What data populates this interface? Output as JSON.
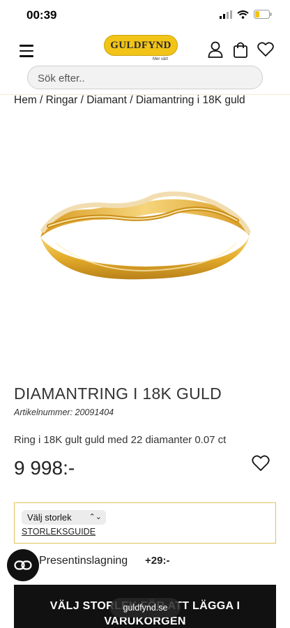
{
  "status_bar": {
    "time": "00:39",
    "icons": [
      "signal-icon",
      "wifi-icon",
      "battery-icon"
    ]
  },
  "header": {
    "logo_text": "GULDFYND",
    "logo_sub": "Mer värt",
    "icons": [
      "menu-icon",
      "account-icon",
      "bag-icon",
      "heart-icon"
    ],
    "search_placeholder": "Sök efter.."
  },
  "breadcrumb": "Hem / Ringar / Diamant / Diamantring i 18K guld",
  "product": {
    "title": "DIAMANTRING I 18K GULD",
    "article_number": "Artikelnummer: 20091404",
    "description": "Ring i 18K gult guld med 22 diamanter 0.07 ct",
    "price": "9 998:-",
    "size_select": "Välj storlek",
    "size_guide": "STORLEKSGUIDE",
    "gift_wrap_label": "Presentinslagning",
    "gift_wrap_price": "+29:-",
    "cta_line1": "VÄLJ STORLEK FÖR ATT LÄGGA I",
    "cta_line2": "VARUKORGEN"
  },
  "browser": {
    "url": "guldfynd.se"
  },
  "colors": {
    "brand_gold": "#f2c417",
    "border_gold": "#e0c35a",
    "cta_bg": "#111111"
  }
}
